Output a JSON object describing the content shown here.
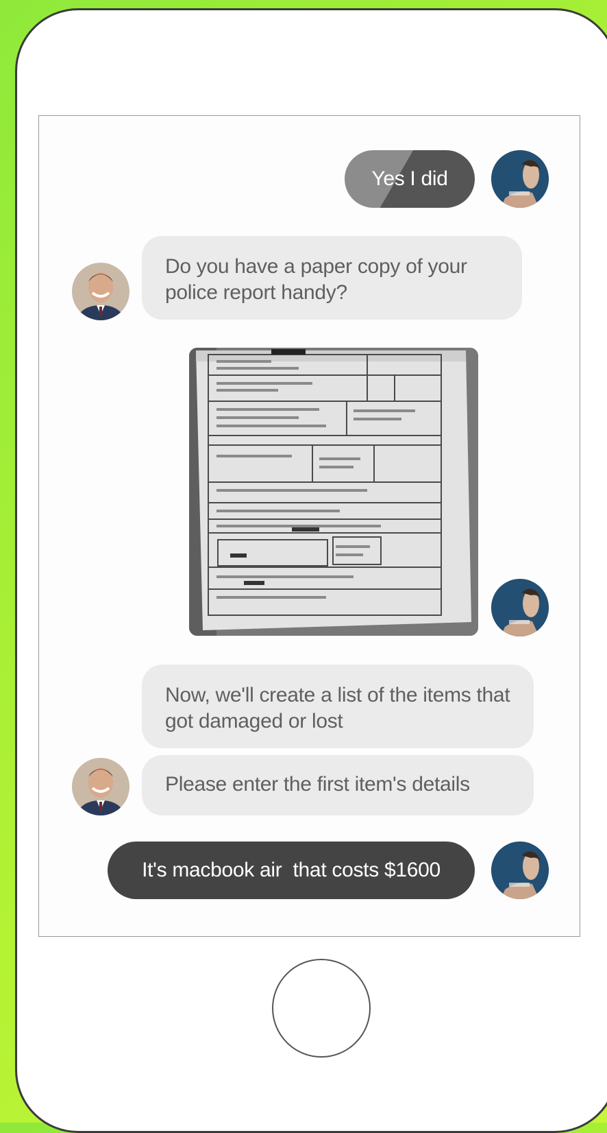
{
  "colors": {
    "background": "#a8ef36",
    "bot_bubble": "#ebebeb",
    "bot_text": "#5f5f5f",
    "user_bubble": "#444444",
    "user_text": "#ffffff"
  },
  "conversation": {
    "messages": [
      {
        "sender": "user",
        "text": "Yes I did",
        "avatar": "user-avatar"
      },
      {
        "sender": "bot",
        "text": "Do you have a paper copy of your police report handy?",
        "avatar": "agent-avatar"
      },
      {
        "sender": "user",
        "type": "image",
        "image": "police-report-photo",
        "avatar": "user-avatar"
      },
      {
        "sender": "bot",
        "text": "Now, we'll create a list of the items that got damaged or lost"
      },
      {
        "sender": "bot",
        "text": "Please enter the first item's details",
        "avatar": "agent-avatar"
      },
      {
        "sender": "user",
        "text": "It's macbook air  that costs $1600",
        "avatar": "user-avatar"
      }
    ]
  },
  "icons": {
    "home_button": "home-button-icon",
    "user_avatar": "user-avatar",
    "agent_avatar": "agent-avatar"
  }
}
